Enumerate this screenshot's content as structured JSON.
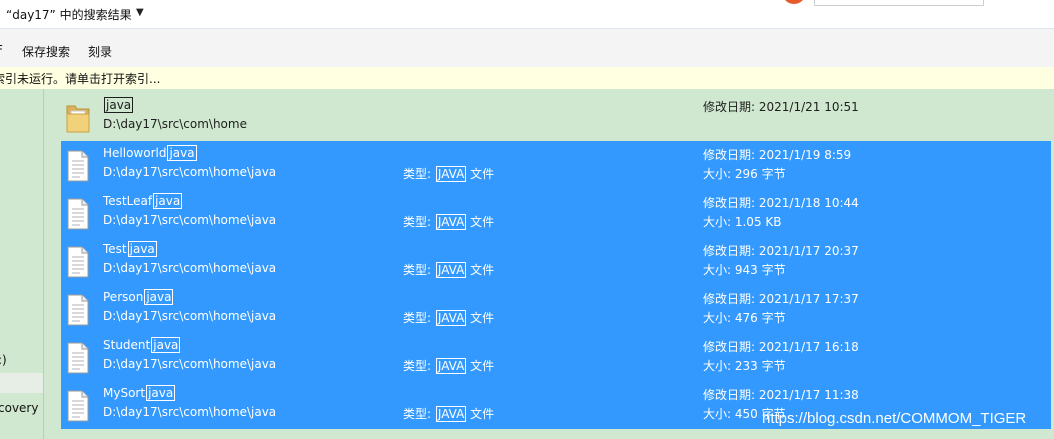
{
  "title": {
    "text": "“day17” 中的搜索结果",
    "arrow": "▼"
  },
  "toolbar": {
    "item_partial": "F",
    "save_search": "保存搜索",
    "burn": "刻录"
  },
  "infobar": {
    "message": "索引未运行。请单击打开索引..."
  },
  "navpane": {
    "item_1": ":)",
    "item_2": "covery ("
  },
  "labels": {
    "modified": "修改日期: ",
    "type": "类型: ",
    "size": "大小: ",
    "file_suffix": " 文件"
  },
  "results": [
    {
      "prefix": "",
      "match": "java",
      "path": "D:\\day17\\src\\com\\home",
      "date": "2021/1/21 10:51",
      "size": "",
      "type_match": "",
      "icon": "folder-icon",
      "selected": false
    },
    {
      "prefix": "Helloworld",
      "match": "java",
      "path": "D:\\day17\\src\\com\\home\\java",
      "date": "2021/1/19 8:59",
      "size": "296 字节",
      "type_match": "JAVA",
      "icon": "file-icon",
      "selected": true
    },
    {
      "prefix": "TestLeaf",
      "match": "java",
      "path": "D:\\day17\\src\\com\\home\\java",
      "date": "2021/1/18 10:44",
      "size": "1.05 KB",
      "type_match": "JAVA",
      "icon": "file-icon",
      "selected": true
    },
    {
      "prefix": "Test",
      "match": "java",
      "path": "D:\\day17\\src\\com\\home\\java",
      "date": "2021/1/17 20:37",
      "size": "943 字节",
      "type_match": "JAVA",
      "icon": "file-icon",
      "selected": true
    },
    {
      "prefix": "Person",
      "match": "java",
      "path": "D:\\day17\\src\\com\\home\\java",
      "date": "2021/1/17 17:37",
      "size": "476 字节",
      "type_match": "JAVA",
      "icon": "file-icon",
      "selected": true
    },
    {
      "prefix": "Student",
      "match": "java",
      "path": "D:\\day17\\src\\com\\home\\java",
      "date": "2021/1/17 16:18",
      "size": "233 字节",
      "type_match": "JAVA",
      "icon": "file-icon",
      "selected": true
    },
    {
      "prefix": "MySort",
      "match": "java",
      "path": "D:\\day17\\src\\com\\home\\java",
      "date": "2021/1/17 11:38",
      "size": "450 字节",
      "type_match": "JAVA",
      "icon": "file-icon",
      "selected": true
    }
  ],
  "watermark": "https://blog.csdn.net/COMMOM_TIGER",
  "colors": {
    "selection": "#3399ff",
    "pane_bg": "#cfe8cf",
    "infobar_bg": "#ffffe1"
  }
}
